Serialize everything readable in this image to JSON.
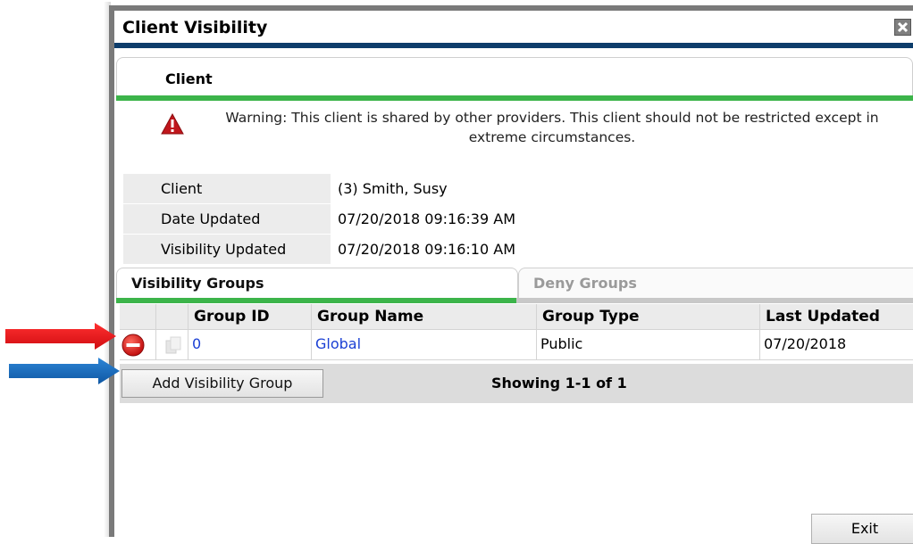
{
  "dialog": {
    "title": "Client Visibility",
    "close_icon": "close-icon"
  },
  "client_section": {
    "tab_label": "Client",
    "warning_text": "Warning: This client is shared by other providers. This client should not be restricted except in extreme circumstances.",
    "rows": [
      {
        "label": "Client",
        "value": "(3) Smith, Susy"
      },
      {
        "label": "Date Updated",
        "value": "07/20/2018 09:16:39 AM"
      },
      {
        "label": "Visibility Updated",
        "value": "07/20/2018 09:16:10 AM"
      }
    ]
  },
  "tabs": [
    {
      "label": "Visibility Groups",
      "active": true
    },
    {
      "label": "Deny Groups",
      "active": false
    }
  ],
  "grid": {
    "columns": [
      "Group ID",
      "Group Name",
      "Group Type",
      "Last Updated"
    ],
    "rows": [
      {
        "group_id": "0",
        "group_name": "Global",
        "group_type": "Public",
        "last_updated": "07/20/2018"
      }
    ]
  },
  "footer": {
    "add_button": "Add Visibility Group",
    "showing": "Showing 1-1 of 1"
  },
  "exit_button": "Exit",
  "colors": {
    "accent_green": "#3cb44a",
    "title_bar_blue": "#0e3d6b",
    "link_blue": "#1a3fd4",
    "arrow_red": "#e8141c",
    "arrow_blue": "#1464b4"
  }
}
